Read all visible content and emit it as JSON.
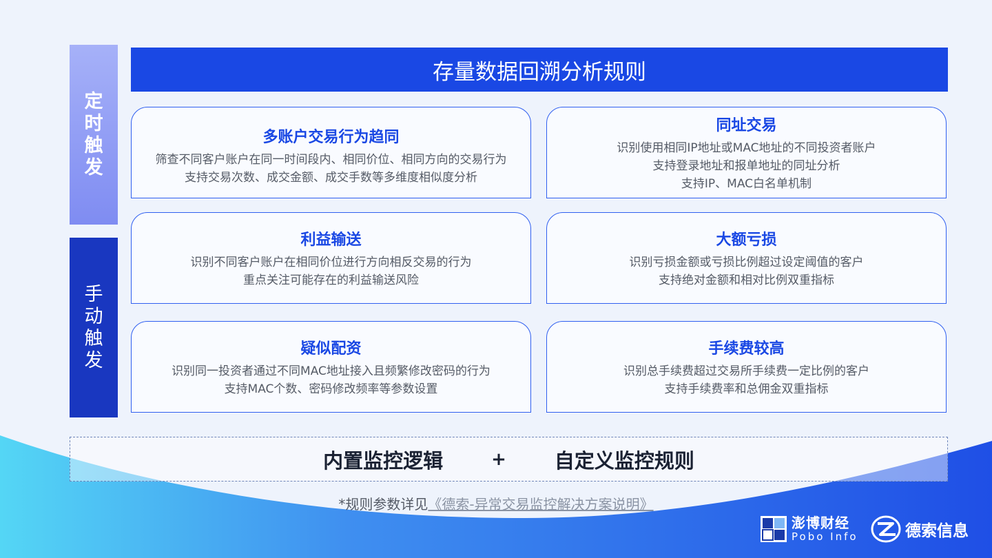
{
  "title": "存量数据回溯分析规则",
  "side_timed": [
    "定",
    "时",
    "触",
    "发"
  ],
  "side_manual": [
    "手",
    "动",
    "触",
    "发"
  ],
  "cards": [
    {
      "title": "多账户交易行为趋同",
      "lines": [
        "筛查不同客户账户在同一时间段内、相同价位、相同方向的交易行为",
        "支持交易次数、成交金额、成交手数等多维度相似度分析"
      ]
    },
    {
      "title": "同址交易",
      "lines": [
        "识别使用相同IP地址或MAC地址的不同投资者账户",
        "支持登录地址和报单地址的同址分析",
        "支持IP、MAC白名单机制"
      ]
    },
    {
      "title": "利益输送",
      "lines": [
        "识别不同客户账户在相同价位进行方向相反交易的行为",
        "重点关注可能存在的利益输送风险"
      ]
    },
    {
      "title": "大额亏损",
      "lines": [
        "识别亏损金额或亏损比例超过设定阈值的客户",
        "支持绝对金额和相对比例双重指标"
      ]
    },
    {
      "title": "疑似配资",
      "lines": [
        "识别同一投资者通过不同MAC地址接入且频繁修改密码的行为",
        "支持MAC个数、密码修改频率等参数设置"
      ]
    },
    {
      "title": "手续费较高",
      "lines": [
        "识别总手续费超过交易所手续费一定比例的客户",
        "支持手续费率和总佣金双重指标"
      ]
    }
  ],
  "bottom": {
    "left": "内置监控逻辑",
    "plus": "+",
    "right": "自定义监控规则"
  },
  "note": {
    "prefix": "*规则参数详见",
    "link": "《德索-异常交易监控解决方案说明》"
  },
  "logos": {
    "pobo_cn": "澎博财经",
    "pobo_en": "Pobo Info",
    "desuo_cn": "德索信息"
  },
  "colors": {
    "accent": "#1a48e4",
    "side_timed": "#8c98f4",
    "side_manual": "#1937c0",
    "background": "#eef3fc"
  }
}
